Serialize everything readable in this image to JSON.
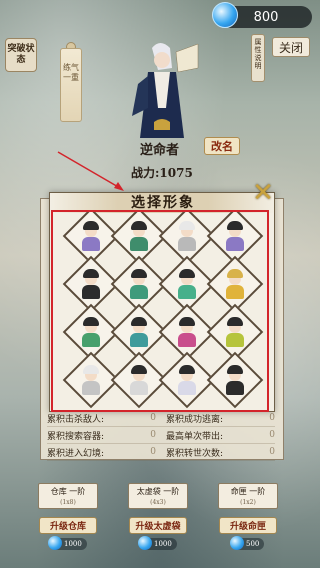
{
  "header": {
    "currency_value": "800",
    "close_label": "关闭",
    "breakthrough_label": "突破状态",
    "attr_desc_label": "属性说明",
    "scroll_tag_label": "练气一重"
  },
  "character": {
    "name": "逆命者",
    "rename_label": "改名",
    "power_label": "战力:1075"
  },
  "modal": {
    "title": "选择形象",
    "close_icon": "cross-icon"
  },
  "portraits": [
    {
      "hair": "#2b2b2b",
      "body": "#8b79c4"
    },
    {
      "hair": "#2b2b2b",
      "body": "#3f8d6c"
    },
    {
      "hair": "#e8e8e8",
      "body": "#b9b9b9"
    },
    {
      "hair": "#2b2b2b",
      "body": "#8b79c4"
    },
    {
      "hair": "#2b2b2b",
      "body": "#2c2c2c"
    },
    {
      "hair": "#2b2b2b",
      "body": "#3f9b7c"
    },
    {
      "hair": "#2b2b2b",
      "body": "#47b08b"
    },
    {
      "hair": "#d8b24a",
      "body": "#e0b33a"
    },
    {
      "hair": "#2b2b2b",
      "body": "#47a06c"
    },
    {
      "hair": "#2b2b2b",
      "body": "#3f9b9b"
    },
    {
      "hair": "#2b2b2b",
      "body": "#c94e8c"
    },
    {
      "hair": "#2b2b2b",
      "body": "#b6c43c"
    },
    {
      "hair": "#e8e8e8",
      "body": "#c4c4c4"
    },
    {
      "hair": "#2b2b2b",
      "body": "#d8d8d8"
    },
    {
      "hair": "#2b2b2b",
      "body": "#d9d9e8"
    },
    {
      "hair": "#2b2b2b",
      "body": "#2c2c2c"
    }
  ],
  "stats": [
    {
      "left": "累积击杀敌人:",
      "left_val": "0",
      "right": "累积成功逃离:",
      "right_val": "0"
    },
    {
      "left": "累积搜索容器:",
      "left_val": "0",
      "right": "最高单次带出:",
      "right_val": "0"
    },
    {
      "left": "累积进入幻境:",
      "left_val": "0",
      "right": "累积转世次数:",
      "right_val": "0"
    }
  ],
  "storage": [
    {
      "name": "仓库 一阶",
      "sub": "(1x8)",
      "upgrade": "升级仓库",
      "cost": "1000"
    },
    {
      "name": "太虚袋 一阶",
      "sub": "(4x3)",
      "upgrade": "升级太虚袋",
      "cost": "1000"
    },
    {
      "name": "命匣 一阶",
      "sub": "(1x2)",
      "upgrade": "升级命匣",
      "cost": "500"
    }
  ],
  "colors": {
    "accent_red": "#d3242b",
    "gold": "#c9a23e"
  }
}
